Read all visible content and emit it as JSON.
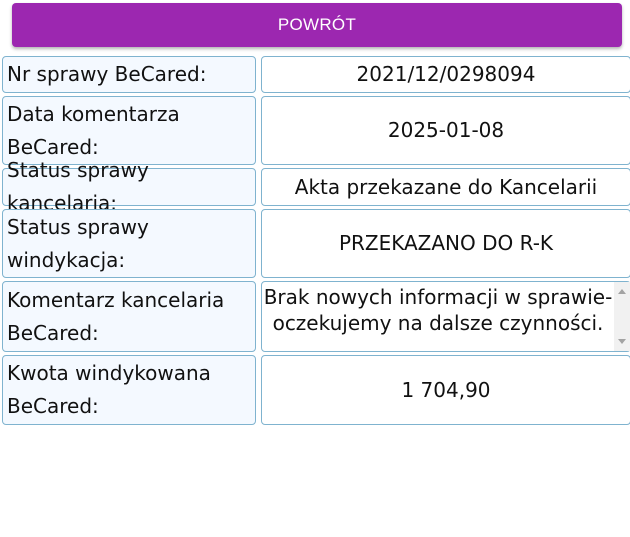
{
  "back_button": {
    "label": "POWRÓT"
  },
  "rows": [
    {
      "label": "Nr sprawy BeCared:",
      "value": "2021/12/0298094"
    },
    {
      "label": "Data komentarza BeCared:",
      "value": "2025-01-08"
    },
    {
      "label": "Status sprawy kancelaria:",
      "value": "Akta przekazane do Kancelarii"
    },
    {
      "label": "Status sprawy windykacja:",
      "value": "PRZEKAZANO DO R-K"
    },
    {
      "label": "Komentarz kancelaria BeCared:",
      "value": "Brak nowych informacji w sprawie- oczekujemy na dalsze czynności."
    },
    {
      "label": "Kwota windykowana BeCared:",
      "value": "1 704,90"
    }
  ],
  "colors": {
    "accent": "#9c27b0",
    "border": "#7fb3cf",
    "label_bg": "#f4f9ff"
  }
}
